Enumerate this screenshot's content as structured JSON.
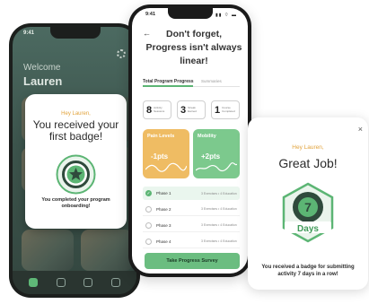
{
  "left_phone": {
    "status_time": "9:41",
    "welcome": "Welcome",
    "name": "Lauren"
  },
  "badge_popup": {
    "greeting": "Hey Lauren,",
    "title": "You received your first badge!",
    "message": "You completed your program onboarding!",
    "accent_color": "#5cb574"
  },
  "center_phone": {
    "status_time": "9:41",
    "status_icons": "▮▮ ⌔ ▬",
    "back": "←",
    "title": "Don't forget, Progress isn't always linear!",
    "tabs": [
      {
        "label": "Total Program Progress",
        "active": true
      },
      {
        "label": "Summaries",
        "active": false
      }
    ],
    "stats": [
      {
        "value": "8",
        "label": "Activity Sessions"
      },
      {
        "value": "3",
        "label": "Streak Earned"
      },
      {
        "value": "1",
        "label": "Course Completed"
      }
    ],
    "levels": [
      {
        "label": "Pain Levels",
        "value": "-1pts",
        "color": "#efbc63"
      },
      {
        "label": "Mobility",
        "value": "+2pts",
        "color": "#7cc98d"
      }
    ],
    "phases": [
      {
        "name": "Phase 1",
        "info": "3 Exercises • 4 Education",
        "done": true
      },
      {
        "name": "Phase 2",
        "info": "3 Exercises • 4 Education",
        "done": false
      },
      {
        "name": "Phase 3",
        "info": "3 Exercises • 4 Education",
        "done": false
      },
      {
        "name": "Phase 4",
        "info": "3 Exercises • 4 Education",
        "done": false
      }
    ],
    "button": "Take Progress Survey"
  },
  "job_popup": {
    "close": "×",
    "greeting": "Hey Lauren,",
    "title": "Great Job!",
    "badge_number": "7",
    "badge_label": "Days",
    "message": "You received a badge for submitting activity 7 days in a row!"
  }
}
